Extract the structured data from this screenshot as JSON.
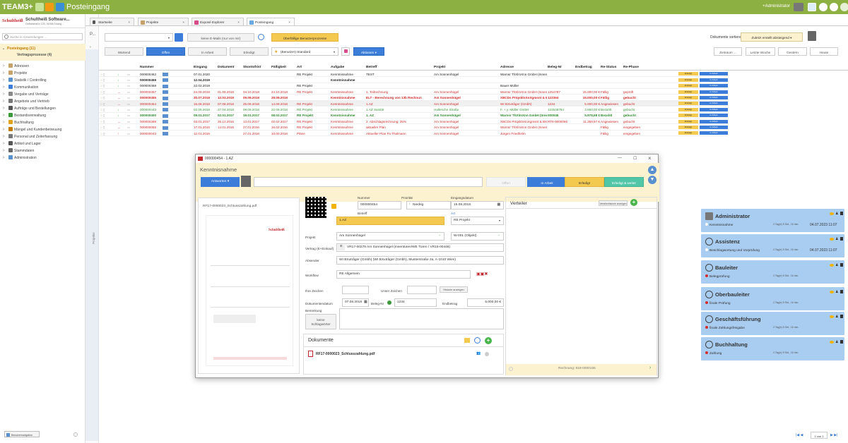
{
  "app": {
    "brand": "TEAM3+",
    "title": "Posteingang",
    "user": "+Administrator"
  },
  "company": {
    "logo": "Schultheiß",
    "name": "Schultheiß Software...",
    "address": "Geibelstraße 125, 91058 Erlang..."
  },
  "search": {
    "placeholder": "Suche in Anwendungen ..."
  },
  "tasks": {
    "posteingang": "Posteingang (11)",
    "vertragsprozesse": "Vertragsprozesse (4)"
  },
  "nav": [
    "Adressen",
    "Projekte",
    "Statistik / Controlling",
    "Kommunikation",
    "Vergabe und Verträge",
    "Angebote und Vertrieb",
    "Aufträge und Bestellungen",
    "Bestandsverwaltung",
    "Buchhaltung",
    "Mängel und Kundenbetreuung",
    "Personal und Zeiterfassung",
    "Artikel und Lager",
    "Stammdaten",
    "Administration"
  ],
  "bottom_button": "Benutzernavigation",
  "side_strip": "Projekte",
  "tabs": [
    "Startseite",
    "Projekte",
    "Exposé Explorer",
    "Posteingang"
  ],
  "toolbar": {
    "p_label": "P...",
    "filter1": "keine E-Mails (nur von mir)",
    "overdue": "Überfällige Benutzerprozesse",
    "sort_label": "Dokumente sortieren nach..",
    "sort_value": "Zuletzt erstellt absteigend"
  },
  "status_buttons": [
    "Wartend",
    "Offen",
    "In Arbeit",
    "Erledigt"
  ],
  "view_select": "(Benutzer) Standard",
  "actions": "Aktionen",
  "time_buttons": [
    "Zeitraum ...",
    "Letzte Woche",
    "Gestern",
    "Heute"
  ],
  "columns": [
    "Nummer",
    "Eingang",
    "Dokument",
    "Skontofrist",
    "Fälligkeit",
    "Art",
    "Aufgabe",
    "Betreff",
    "Projekt",
    "Adresse",
    "Beleg-Nr",
    "Endbetrag",
    "Re-Status",
    "Re-Phase"
  ],
  "rows": [
    {
      "nummer": "000000462",
      "eingang": "07.01.2020",
      "dokument": "",
      "skonto": "",
      "faellig": "",
      "art": "RE Projekt",
      "aufgabe": "Kenntnisnahme",
      "betreff": "TEST",
      "projekt": "Am Sonnenhügel",
      "adresse": "Warnsr ThXlmXnn GmbH (Innen-, Zm",
      "beleg": "",
      "endbetrag": "",
      "restatus": "",
      "rephase": "",
      "color": "#222",
      "bold": false
    },
    {
      "nummer": "000000459",
      "eingang": "12.04.2019",
      "dokument": "",
      "skonto": "",
      "faellig": "",
      "art": "",
      "aufgabe": "Kenntnisnahme",
      "betreff": "",
      "projekt": "",
      "adresse": "",
      "beleg": "",
      "endbetrag": "",
      "restatus": "",
      "rephase": "",
      "color": "#222",
      "bold": true
    },
    {
      "nummer": "000000458",
      "eingang": "22.02.2019",
      "dokument": "",
      "skonto": "",
      "faellig": "",
      "art": "RE Projekt",
      "aufgabe": "",
      "betreff": "",
      "projekt": "",
      "adresse": "Bauer Müller",
      "beleg": "",
      "endbetrag": "",
      "restatus": "",
      "rephase": "",
      "color": "#222",
      "bold": false
    },
    {
      "nummer": "000000457",
      "eingang": "24.09.2018",
      "dokument": "01.09.2018",
      "skonto": "04.10.2018",
      "faellig": "24.10.2018",
      "art": "RE Projekt",
      "aufgabe": "Kenntnisnahme",
      "betreff": "1. Teilrechnung",
      "projekt": "Am Sonnenhügel",
      "adresse": "Warnsr ThXlmXnn GmbH (Innen-, Zm",
      "beleg": "1254787",
      "endbetrag": "15.000,00 €",
      "restatus": "Fällig",
      "rephase": "geprüft",
      "color": "#d42d2d",
      "bold": false
    },
    {
      "nummer": "000000455",
      "eingang": "30.07.2018",
      "dokument": "12.03.2019",
      "skonto": "09.08.2018",
      "faellig": "29.08.2018",
      "art": "",
      "aufgabe": "Kenntnisnahme",
      "betreff": "ELT - Berechnung von 13b Rechnun",
      "projekt": "Am Sonnenhügel",
      "adresse": "XBCDs PrtqsktnXnXgmsnt & BX",
      "beleg": "122364",
      "endbetrag": "15.000,00 €",
      "restatus": "Fällig",
      "rephase": "gebucht",
      "color": "#d42d2d",
      "bold": true
    },
    {
      "nummer": "000000454",
      "eingang": "15.08.2018",
      "dokument": "07.08.2018",
      "skonto": "25.08.2018",
      "faellig": "14.09.2018",
      "art": "RE Projekt",
      "aufgabe": "Kenntnisnahme",
      "betreff": "1.AZ",
      "projekt": "Am Sonnenhügel",
      "adresse": "WI BXutrâger (Gmbh)",
      "beleg": "1234",
      "endbetrag": "5.000,00 €",
      "restatus": "Angewiesen",
      "rephase": "gebucht",
      "color": "#d42d2d",
      "bold": false
    },
    {
      "nummer": "000000443",
      "eingang": "02.05.2018",
      "dokument": "27.04.2018",
      "skonto": "09.05.2018",
      "faellig": "22.05.2018",
      "art": "RE Projekt",
      "aufgabe": "Kenntnisnahme",
      "betreff": "1.AZ Sanitär",
      "projekt": "Hallesche Straße",
      "adresse": "F. + y. Müller GmbH",
      "beleg": "124548784",
      "endbetrag": "3.650,00 €",
      "restatus": "Bezahlt",
      "rephase": "gebucht",
      "color": "#3a9a3a",
      "bold": false
    },
    {
      "nummer": "000000400",
      "eingang": "09.01.2017",
      "dokument": "02.01.2017",
      "skonto": "19.01.2017",
      "faellig": "08.02.2017",
      "art": "RE Projekt",
      "aufgabe": "Kenntnisnahme",
      "betreff": "1. AZ",
      "projekt": "Am Sonnenhügel",
      "adresse": "Warnsr ThXlmXnn GmbH (Innen-...",
      "beleg": "000045",
      "endbetrag": "5.978,68 €",
      "restatus": "Bezahlt",
      "rephase": "gebucht",
      "color": "#2d8c2d",
      "bold": true
    },
    {
      "nummer": "000000398",
      "eingang": "03.01.2017",
      "dokument": "26.12.2016",
      "skonto": "13.01.2017",
      "faellig": "02.02.2017",
      "art": "RE Projekt",
      "aufgabe": "Kenntnisnahme",
      "betreff": "2. Abschlagsrechnung: 25%",
      "projekt": "Am Sonnenhügel",
      "adresse": "XBCDs PrtqsktnXnXgmsnt & BXuts",
      "beleg": "RT6-0000066",
      "endbetrag": "11.359,97 €",
      "restatus": "Angewiesen",
      "rephase": "gebucht",
      "color": "#d42d2d",
      "bold": false
    },
    {
      "nummer": "000000055",
      "eingang": "17.01.2016",
      "dokument": "14.01.2016",
      "skonto": "27.01.2016",
      "faellig": "16.02.2016",
      "art": "RE Projekt",
      "aufgabe": "Kenntnisnahme",
      "betreff": "aktueller Plan",
      "projekt": "Am Sonnenhügel",
      "adresse": "Warnsr ThXlmXnn GmbH (Innen-, Zm",
      "beleg": "",
      "endbetrag": "",
      "restatus": "Fällig",
      "rephase": "eingegeben",
      "color": "#d42d2d",
      "bold": false
    },
    {
      "nummer": "000000043",
      "eingang": "12.01.2016",
      "dokument": "",
      "skonto": "27.01.2018",
      "faellig": "10.00.2018",
      "art": "Pläne",
      "aufgabe": "Kenntnisnahme",
      "betreff": "Aktueller Plan Fa Thalmann",
      "projekt": "Am Sonnenhügel",
      "adresse": "Jürgen Friedhelm",
      "beleg": "",
      "endbetrag": "",
      "restatus": "Fällig",
      "rephase": "eingegeben",
      "color": "#d42d2d",
      "bold": false
    }
  ],
  "row_badges": {
    "erledigt": "Erledigt",
    "inarbeit": "In Arbeit"
  },
  "pagination": {
    "label": "1 von 1"
  },
  "dialog": {
    "title": "000000454 - 1.AZ",
    "caption": "Kenntnisnahme",
    "answer_button": "Antworten",
    "buttons": [
      "Offen",
      "In Arbeit",
      "Erledigt",
      "Erledigt & weiter"
    ],
    "preview_filename": "RF17-0000023_Schlusszahlung.pdf",
    "preview_logo": "Schultheiß",
    "labels": {
      "nummer": "Nummer",
      "prioritaet": "Priorität",
      "eingangsdatum": "Eingangsdatum",
      "betreff": "Betreff",
      "art": "Art",
      "projekt": "Projekt",
      "vertrag": "Vertrag (E+Einkauf)",
      "absender": "Absender",
      "workflow": "Workflow",
      "ihre_zeichen": "Ihre Zeichen",
      "unser_zeichen": "Unser Zeichen",
      "dokumentendatum": "Dokumentendatum",
      "beleg_nr": "Beleg-Nr",
      "endbetrag": "Endbetrag",
      "bemerkung": "Bemerkung"
    },
    "values": {
      "nummer": "000000454",
      "prioritaet": "Niedrig",
      "eingangsdatum": "15.08.2018",
      "betreff": "1.AZ",
      "art": "RE Projekt",
      "projekt": "Am Sonnenhügel",
      "projekt_code": "W-001 (Objekt)",
      "vertrag_e": "E",
      "vertrag": "VR17-00279 Am Sonnenhügel (Innentüren/WE Türen / VR15-00446)",
      "absender": "WI BXutrâger (Gmbh) (WI BXutrâger (Gmbh), Musterstraße 2a, A-1010 Wien)",
      "workflow": "RE Allgemein",
      "dokumentendatum": "07.08.2018",
      "beleg_nr": "1234",
      "endbetrag": "5.000,00 €"
    },
    "history_button": "Historie anzeigen",
    "keywords_button": "keine Schlagwörter",
    "documents_title": "Dokumente",
    "document_file": "RF17-0000023_Schlusszahlung.pdf",
    "verteiler_title": "Verteiler",
    "verteiler_history": "Verteilerhistorie anzeigen",
    "cards": [
      {
        "name": "Administrator",
        "task": "Kenntnisnahme",
        "time": "2 Tag(e) 5 Std., 16 min.",
        "date": "04.07.2023 11:07",
        "dot": "#ffffff"
      },
      {
        "name": "Assistenz",
        "task": "Beschlagwortung und Vorprüfung",
        "time": "2 Tag(e) 5 Std., 16 min.",
        "date": "04.07.2023 11:07",
        "dot": "#ffffff"
      },
      {
        "name": "Bauleiter",
        "task": "Belegprüfung",
        "time": "2 Tag(e) 5 Std., 16 min.",
        "date": "",
        "dot": "#d42d2d"
      },
      {
        "name": "Oberbauleiter",
        "task": "finale Prüfung",
        "time": "2 Tag(e) 5 Std., 16 min.",
        "date": "",
        "dot": "#d42d2d"
      },
      {
        "name": "Geschäftsführung",
        "task": "finale Zahlungsfreigabe",
        "time": "2 Tag(e) 5 Std., 16 min.",
        "date": "",
        "dot": "#d42d2d"
      },
      {
        "name": "Buchhaltung",
        "task": "Zahlung",
        "time": "2 Tag(e) 5 Std., 16 min.",
        "date": "",
        "dot": "#d42d2d"
      }
    ],
    "footer": "Rechnung: 818-0000155"
  }
}
